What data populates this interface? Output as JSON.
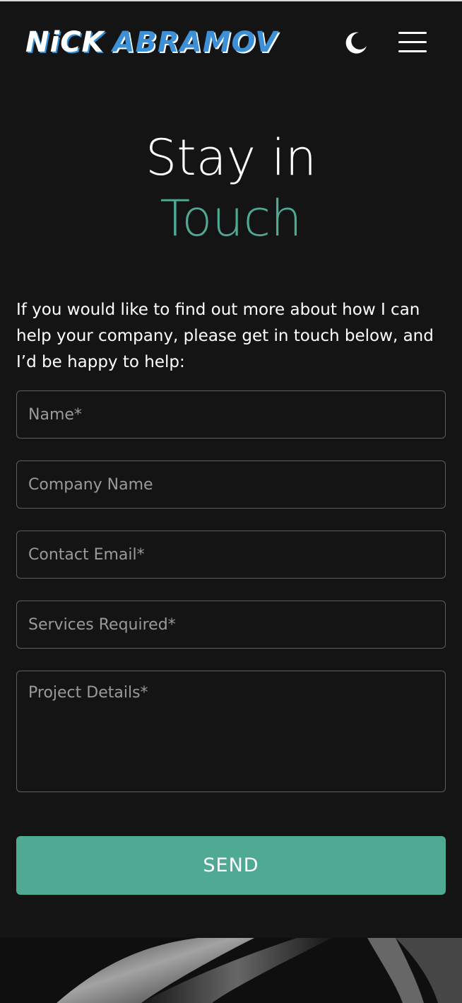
{
  "header": {
    "logo_first": "NiCK",
    "logo_last": "ABRAMOV",
    "theme_icon": "moon-icon",
    "menu_icon": "hamburger-menu-icon"
  },
  "heading": {
    "line1": "Stay in",
    "line2": "Touch"
  },
  "intro": {
    "text": "If you would like to find out more about how I can help your company, please get in touch below, and I’d be happy to help:"
  },
  "form": {
    "name_placeholder": "Name*",
    "company_placeholder": "Company Name",
    "email_placeholder": "Contact Email*",
    "services_placeholder": "Services Required*",
    "details_placeholder": "Project Details*",
    "send_label": "SEND"
  },
  "colors": {
    "background": "#141414",
    "accent": "#4fa993",
    "logo_blue": "#3d8fd6",
    "field_border": "#5d5d5d",
    "placeholder": "#9a9a9a"
  }
}
